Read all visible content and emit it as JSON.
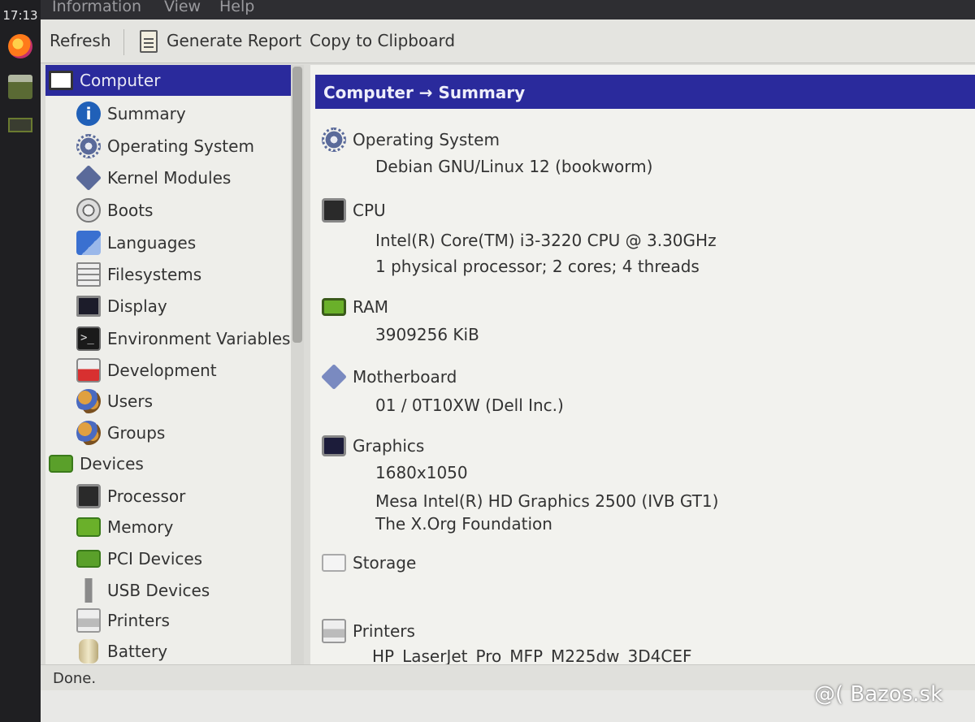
{
  "taskbar": {
    "clock": "17:13"
  },
  "menu": {
    "items": [
      "Information",
      "View",
      "Help"
    ]
  },
  "toolbar": {
    "refresh": "Refresh",
    "generate_report": "Generate Report",
    "copy_clipboard": "Copy to Clipboard"
  },
  "sidebar": {
    "computer": "Computer",
    "computer_items": [
      "Summary",
      "Operating System",
      "Kernel Modules",
      "Boots",
      "Languages",
      "Filesystems",
      "Display",
      "Environment Variables",
      "Development",
      "Users",
      "Groups"
    ],
    "devices": "Devices",
    "device_items": [
      "Processor",
      "Memory",
      "PCI Devices",
      "USB Devices",
      "Printers",
      "Battery"
    ]
  },
  "content": {
    "header": "Computer → Summary",
    "sections": [
      {
        "title": "Operating System",
        "values": [
          "Debian GNU/Linux 12 (bookworm)"
        ]
      },
      {
        "title": "CPU",
        "values": [
          "Intel(R) Core(TM) i3-3220 CPU @ 3.30GHz",
          "1 physical processor; 2 cores; 4 threads"
        ]
      },
      {
        "title": "RAM",
        "values": [
          "3909256 KiB"
        ]
      },
      {
        "title": "Motherboard",
        "values": [
          "01 / 0T10XW (Dell Inc.)"
        ]
      },
      {
        "title": "Graphics",
        "values": [
          "1680x1050",
          "Mesa Intel(R) HD Graphics 2500 (IVB GT1)",
          "The X.Org Foundation"
        ]
      },
      {
        "title": "Storage",
        "values": []
      },
      {
        "title": "Printers",
        "values": [
          "HP_LaserJet_Pro_MFP_M225dw_3D4CEF"
        ]
      }
    ]
  },
  "status": {
    "text": "Done."
  },
  "watermark": "@( Bazos.sk"
}
